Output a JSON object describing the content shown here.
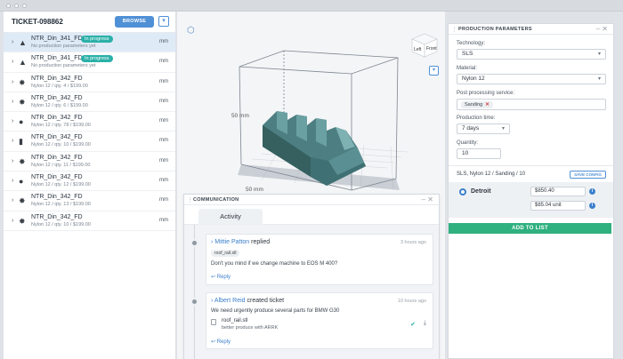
{
  "sidebar": {
    "ticket_id": "TICKET-098862",
    "browse_label": "BROWSE",
    "items": [
      {
        "name": "NTR_Din_341_FD",
        "badge": "In progress",
        "sub": "No production parameters yet",
        "unit": "mm",
        "selected": true
      },
      {
        "name": "NTR_Din_341_FD",
        "badge": "In progress",
        "sub": "No production parameters yet",
        "unit": "mm",
        "selected": false
      },
      {
        "name": "NTR_Din_342_FD",
        "badge": "",
        "sub": "Nylon 12 / qty. 4 / $199.00",
        "unit": "mm"
      },
      {
        "name": "NTR_Din_342_FD",
        "badge": "",
        "sub": "Nylon 12 / qty. 6 / $199.00",
        "unit": "mm"
      },
      {
        "name": "NTR_Din_342_FD",
        "badge": "",
        "sub": "Nylon 12 / qty. 78 / $199.00",
        "unit": "mm"
      },
      {
        "name": "NTR_Din_342_FD",
        "badge": "",
        "sub": "Nylon 12 / qty. 10 / $199.00",
        "unit": "mm"
      },
      {
        "name": "NTR_Din_342_FD",
        "badge": "",
        "sub": "Nylon 12 / qty. 11 / $199.00",
        "unit": "mm"
      },
      {
        "name": "NTR_Din_342_FD",
        "badge": "",
        "sub": "Nylon 12 / qty. 12 / $199.00",
        "unit": "mm"
      },
      {
        "name": "NTR_Din_342_FD",
        "badge": "",
        "sub": "Nylon 12 / qty. 13 / $199.00",
        "unit": "mm"
      },
      {
        "name": "NTR_Din_342_FD",
        "badge": "",
        "sub": "Nylon 12 / qty. 10 / $199.00",
        "unit": "mm"
      }
    ]
  },
  "viewer": {
    "cube_left": "Left",
    "cube_front": "Front",
    "dim_height": "50 mm",
    "dim_width": "50 mm",
    "model_color": "#4d7f82"
  },
  "communication": {
    "title": "COMMUNICATION",
    "tab_activity": "Activity",
    "entries": [
      {
        "author": "Mittie Patton",
        "action": "replied",
        "time": "3 hours ago",
        "chip": "roof_rail.stl",
        "text": "Don't you mind if we change machine to EOS M 400?",
        "reply": "Reply"
      },
      {
        "author": "Albert Reid",
        "action": "created ticket",
        "time": "10 hours ago",
        "text": "We need urgently produce several parts for BMW G30",
        "file_name": "roof_rail.stl",
        "file_note": "better produce with ARRK",
        "reply": "Reply"
      }
    ]
  },
  "production": {
    "title": "PRODUCTION PARAMETERS",
    "technology_label": "Technology:",
    "technology_value": "SLS",
    "material_label": "Material:",
    "material_value": "Nylon 12",
    "post_label": "Post processing service:",
    "post_tag": "Sanding",
    "time_label": "Production time:",
    "time_value": "7 days",
    "quantity_label": "Quantity:",
    "quantity_value": "10",
    "summary": "SLS, Nylon 12 / Sanding / 10",
    "save_config": "SAVE CONFIG",
    "location": "Detroit",
    "price_total": "$850.40",
    "price_unit": "$85.04 unit",
    "add_to_list": "ADD TO LIST"
  },
  "colors": {
    "accent": "#4f90d6",
    "badge": "#2bb0a8",
    "add": "#2fb07f"
  }
}
